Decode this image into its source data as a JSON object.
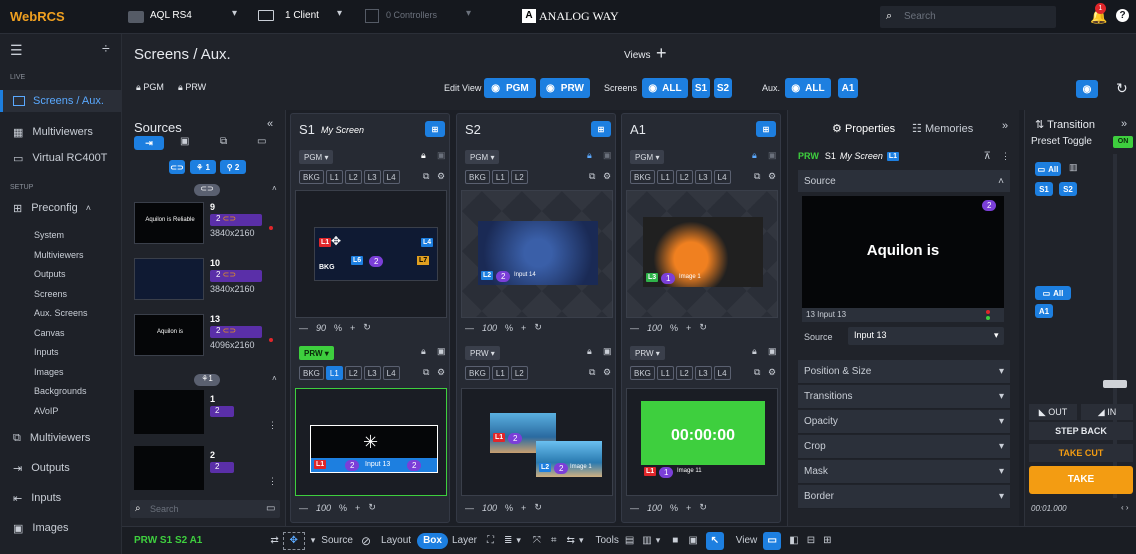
{
  "topbar": {
    "logo": "WebRCS",
    "device": "AQL RS4",
    "clients": "1 Client",
    "controllers": "0 Controllers",
    "brand": "ANALOG WAY",
    "search_placeholder": "Search",
    "notifications": "1"
  },
  "sidebar": {
    "live_label": "LIVE",
    "setup_label": "SETUP",
    "items": [
      "Screens / Aux.",
      "Multiviewers",
      "Virtual RC400T",
      "Preconfig"
    ],
    "preconfig_sub": [
      "System",
      "Multiviewers",
      "Outputs",
      "Screens",
      "Aux. Screens",
      "Canvas",
      "Inputs",
      "Images",
      "Backgrounds",
      "AVoIP"
    ],
    "bottom": [
      "Multiviewers",
      "Outputs",
      "Inputs",
      "Images"
    ]
  },
  "header": {
    "title": "Screens / Aux.",
    "views": "Views",
    "pgm": "PGM",
    "prw": "PRW",
    "edit_view": "Edit View",
    "edit_pgm": "PGM",
    "edit_prw": "PRW",
    "screens": "Screens",
    "screens_all": "ALL",
    "s1": "S1",
    "s2": "S2",
    "aux": "Aux.",
    "aux_all": "ALL",
    "a1": "A1"
  },
  "sources": {
    "title": "Sources",
    "items": [
      {
        "num": "9",
        "res": "3840x2160",
        "thumb": "Aquilon is Reliable"
      },
      {
        "num": "10",
        "res": "3840x2160"
      },
      {
        "num": "13",
        "res": "4096x2160",
        "thumb": "Aquilon is"
      }
    ],
    "bg_items": [
      {
        "num": "1"
      },
      {
        "num": "2"
      }
    ],
    "layer_count": "2",
    "search_placeholder": "Search"
  },
  "screens": [
    {
      "id": "S1",
      "name": "My Screen",
      "pgm": "PGM",
      "prw": "PRW",
      "layers": [
        "BKG",
        "L1",
        "L2",
        "L3",
        "L4"
      ],
      "zoom_pgm": "90",
      "zoom_prw": "100"
    },
    {
      "id": "S2",
      "name": "",
      "pgm": "PGM",
      "prw": "PRW",
      "layers": [
        "BKG",
        "L1",
        "L2"
      ],
      "zoom_pgm": "100",
      "zoom_prw": "100",
      "input_label": "Input 14",
      "image_label": "Image 1"
    },
    {
      "id": "A1",
      "name": "",
      "pgm": "PGM",
      "prw": "PRW",
      "layers": [
        "BKG",
        "L1",
        "L2",
        "L3",
        "L4"
      ],
      "zoom_pgm": "100",
      "zoom_prw": "100",
      "image_label": "Image 1",
      "timer": "00:00:00",
      "image11": "Image 11"
    }
  ],
  "properties": {
    "tab_properties": "Properties",
    "tab_memories": "Memories",
    "prw_label": "PRW",
    "screen_label": "S1",
    "screen_name": "My Screen",
    "layer": "L1",
    "source_section": "Source",
    "preview_text": "Aquilon is",
    "input_caption": "13 Input 13",
    "source_label": "Source",
    "source_value": "Input 13",
    "rows": [
      "Position & Size",
      "Transitions",
      "Opacity",
      "Crop",
      "Mask",
      "Border"
    ]
  },
  "transition": {
    "title": "Transition",
    "preset_toggle": "Preset Toggle",
    "on": "ON",
    "all": "All",
    "s1": "S1",
    "s2": "S2",
    "a1": "A1",
    "out": "OUT",
    "in": "IN",
    "step_back": "STEP BACK",
    "take_cut": "TAKE CUT",
    "take": "TAKE",
    "time": "00:01.000"
  },
  "bottombar": {
    "selection": "PRW S1 S2 A1",
    "source": "Source",
    "layout": "Layout",
    "box": "Box",
    "layer": "Layer",
    "tools": "Tools",
    "view": "View"
  }
}
